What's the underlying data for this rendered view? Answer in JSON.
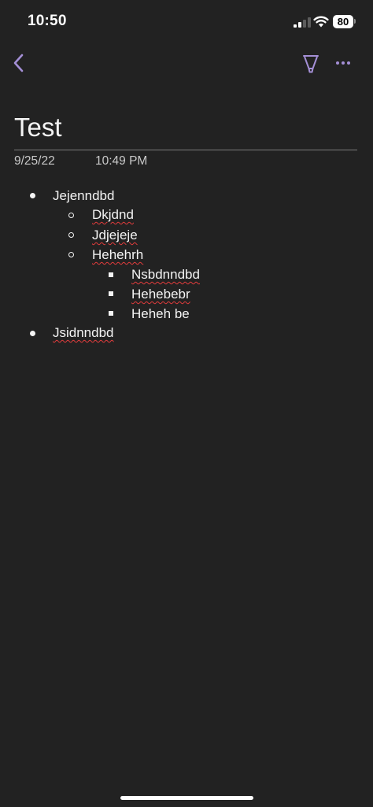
{
  "status_bar": {
    "time": "10:50",
    "battery": "80",
    "signal_icon": "cellular-signal-icon",
    "wifi_icon": "wifi-icon"
  },
  "toolbar": {
    "back_icon": "chevron-left-icon",
    "pen_icon": "highlighter-pen-icon",
    "more_icon": "more-options-icon",
    "accent_color": "#a48fd6"
  },
  "page": {
    "title": "Test",
    "date": "9/25/22",
    "time": "10:49 PM"
  },
  "outline": [
    {
      "text": "Jejenndbd",
      "level": 1,
      "bullet": "disc",
      "misspelled": false
    },
    {
      "text": "Dkjdnd",
      "level": 2,
      "bullet": "circle",
      "misspelled": true
    },
    {
      "text": "Jdjejeje",
      "level": 2,
      "bullet": "circle",
      "misspelled": true
    },
    {
      "text": "Hehehrh",
      "level": 2,
      "bullet": "circle",
      "misspelled": true
    },
    {
      "text": "Nsbdnndbd",
      "level": 3,
      "bullet": "square",
      "misspelled": true
    },
    {
      "text": "Hehebebr",
      "level": 3,
      "bullet": "square",
      "misspelled": true
    },
    {
      "text": "Heheh be",
      "level": 3,
      "bullet": "square",
      "misspelled": false
    },
    {
      "text": "Jsidnndbd",
      "level": 1,
      "bullet": "disc",
      "misspelled": true
    }
  ]
}
